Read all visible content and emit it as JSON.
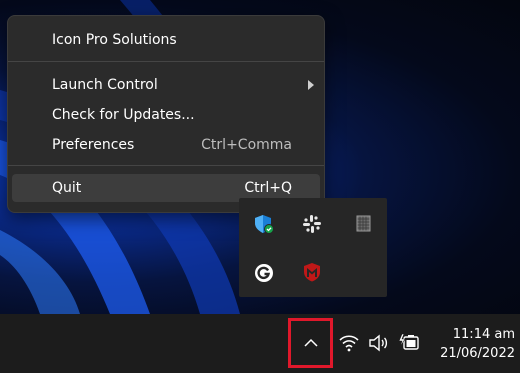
{
  "menu": {
    "title": "Icon Pro Solutions",
    "items": [
      {
        "label": "Launch Control",
        "shortcut": "",
        "submenu": true
      },
      {
        "label": "Check for Updates...",
        "shortcut": ""
      },
      {
        "label": "Preferences",
        "shortcut": "Ctrl+Comma"
      },
      {
        "label": "Quit",
        "shortcut": "Ctrl+Q",
        "hovered": true
      }
    ]
  },
  "tray": {
    "icons": [
      "windows-security-icon",
      "slack-icon",
      "app-grid-icon",
      "grammarly-icon",
      "mcafee-icon"
    ]
  },
  "taskbar": {
    "time": "11:14 am",
    "date": "21/06/2022",
    "highlight_color": "#e0182b"
  }
}
